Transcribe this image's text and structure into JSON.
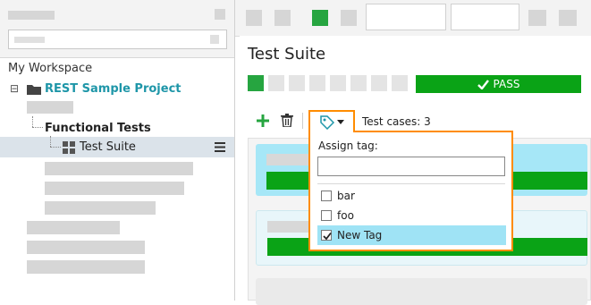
{
  "tree": {
    "workspace_label": "My Workspace",
    "project_label": "REST Sample Project",
    "functional_tests_label": "Functional Tests",
    "test_suite_label": "Test Suite",
    "expand_symbol": "⊟"
  },
  "suite": {
    "title": "Test Suite",
    "pass_label": "PASS",
    "test_cases_label": "Test cases: 3"
  },
  "toolbar": {
    "add_icon": "add-icon",
    "delete_icon": "trash-icon",
    "tag_icon": "tag-icon"
  },
  "tag_popup": {
    "assign_label": "Assign tag:",
    "input_value": "",
    "tags": [
      {
        "label": "bar",
        "checked": false
      },
      {
        "label": "foo",
        "checked": false
      },
      {
        "label": "New Tag",
        "checked": true
      }
    ]
  },
  "colors": {
    "accent_orange": "#ff8c00",
    "pass_green": "#0aa316",
    "project_teal": "#1e96a8",
    "selected_tag_bg": "#9fe3f5",
    "case_card_bg": "#a6e7f7"
  }
}
